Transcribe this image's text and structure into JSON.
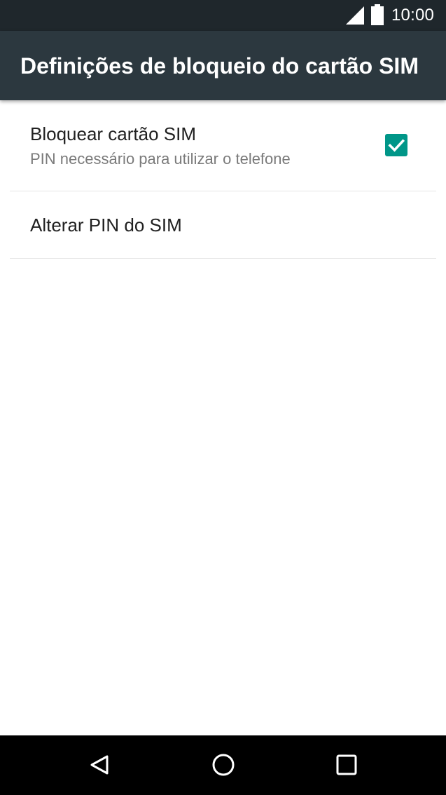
{
  "status_bar": {
    "time": "10:00",
    "icons": [
      "signal-icon",
      "battery-icon"
    ]
  },
  "app_bar": {
    "title": "Definições de bloqueio do cartão SIM"
  },
  "preferences": [
    {
      "title": "Bloquear cartão SIM",
      "summary": "PIN necessário para utilizar o telefone",
      "checked": true
    },
    {
      "title": "Alterar PIN do SIM"
    }
  ],
  "navigation_bar": {
    "buttons": [
      "back-icon",
      "home-icon",
      "recents-icon"
    ]
  },
  "colors": {
    "status_bar": "#1f272c",
    "app_bar": "#2c383f",
    "accent": "#009688",
    "background": "#ffffff"
  }
}
